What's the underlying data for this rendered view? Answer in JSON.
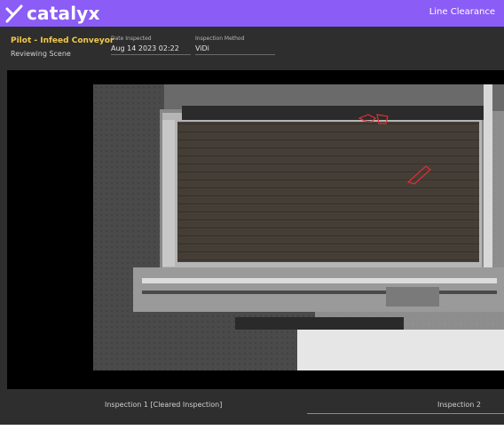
{
  "header": {
    "logo_text": "catalyx",
    "app_title": "Line Clearance",
    "brand_color": "#8b5cf6"
  },
  "info": {
    "station_name": "Pilot - Infeed Conveyor",
    "status": "Reviewing Scene",
    "date_label": "Date Inspected",
    "date_value": "Aug 14 2023 02:22",
    "method_label": "Inspection Method",
    "method_value": "ViDi",
    "highlight_color": "#f2c94c"
  },
  "viewer": {
    "image_description_icon": "inspection-image",
    "detection_color": "#e03030"
  },
  "tabs": [
    {
      "label": "Inspection 1 [Cleared Inspection]"
    },
    {
      "label": "Inspection 2"
    }
  ]
}
